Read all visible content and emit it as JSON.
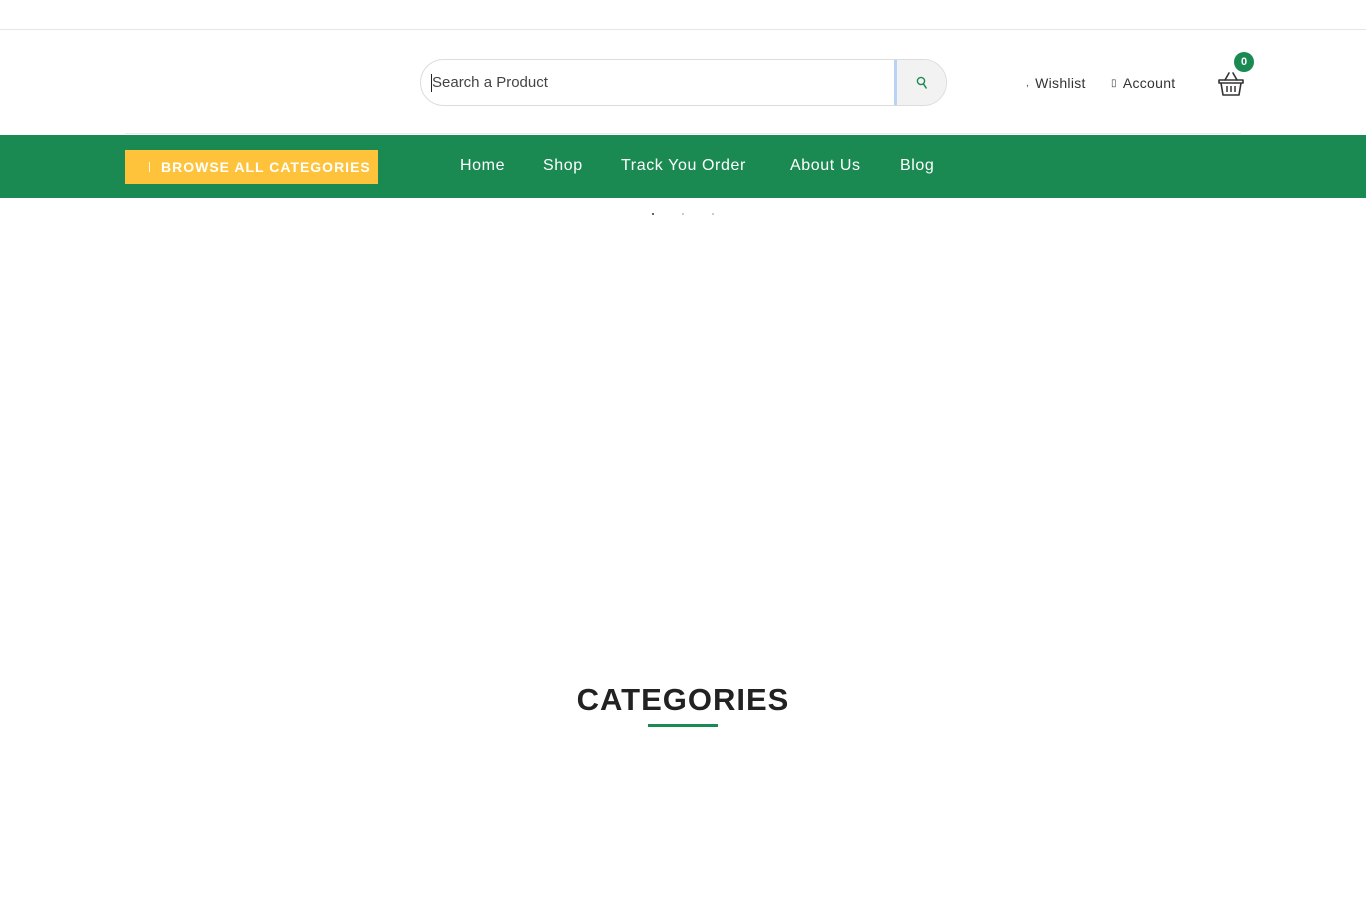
{
  "search": {
    "placeholder": "Search a Product"
  },
  "header": {
    "wishlist_label": "Wishlist",
    "account_label": "Account",
    "cart_count": "0"
  },
  "nav": {
    "browse_label": "BROWSE ALL CATEGORIES",
    "items": [
      {
        "label": "Home"
      },
      {
        "label": "Shop"
      },
      {
        "label": "Track You Order"
      },
      {
        "label": "About Us"
      },
      {
        "label": "Blog"
      }
    ]
  },
  "slider": {
    "dot_count": 3,
    "active_index": 0
  },
  "sections": {
    "categories_title": "CATEGORIES"
  },
  "colors": {
    "brand_green": "#1b8a52",
    "browse_yellow": "#fec33b"
  },
  "icons": {
    "search": "search-icon",
    "wishlist": "heart-icon",
    "account": "user-icon",
    "cart": "basket-icon",
    "browse": "menu-bars-icon"
  }
}
